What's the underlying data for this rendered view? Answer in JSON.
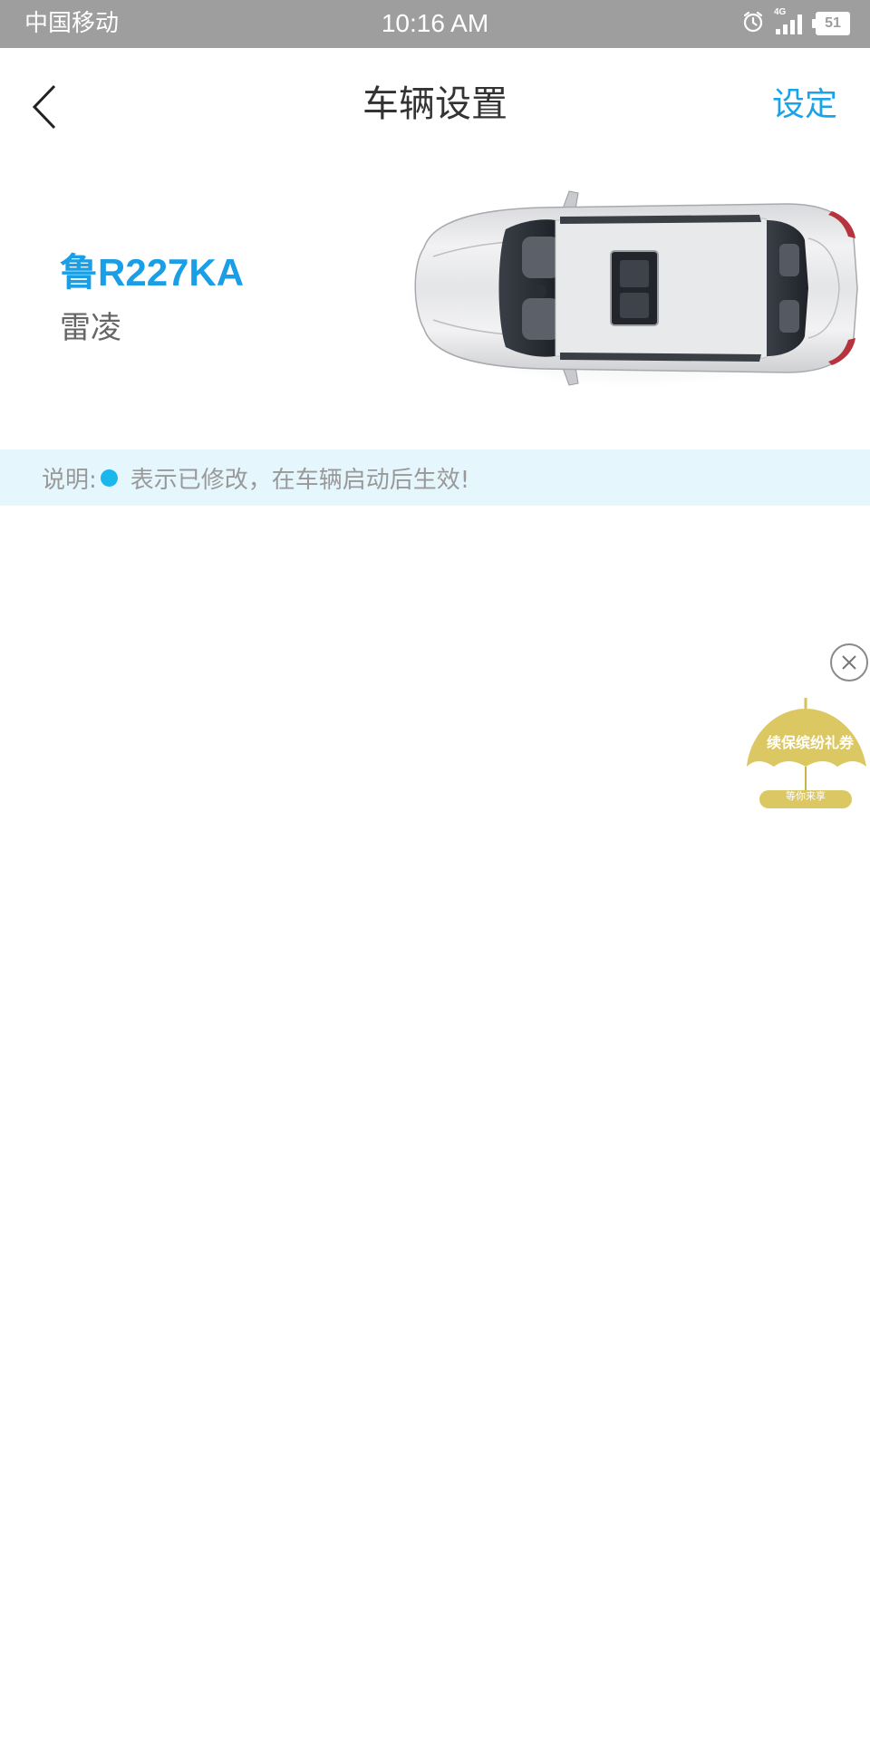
{
  "status_bar": {
    "carrier": "中国移动",
    "time": "10:16 AM",
    "network": "4G",
    "battery": "51"
  },
  "nav": {
    "title": "车辆设置",
    "action_label": "设定"
  },
  "car": {
    "plate": "鲁R227KA",
    "model": "雷凌"
  },
  "notice": {
    "label": "说明:",
    "text": "表示已修改，在车辆启动后生效!"
  },
  "promo": {
    "title": "续保缤纷礼券",
    "subtitle": "等你来享"
  },
  "colors": {
    "accent": "#1aa3e8",
    "notice_bg": "#e6f6fd",
    "status_bar_bg": "#9e9e9e"
  }
}
